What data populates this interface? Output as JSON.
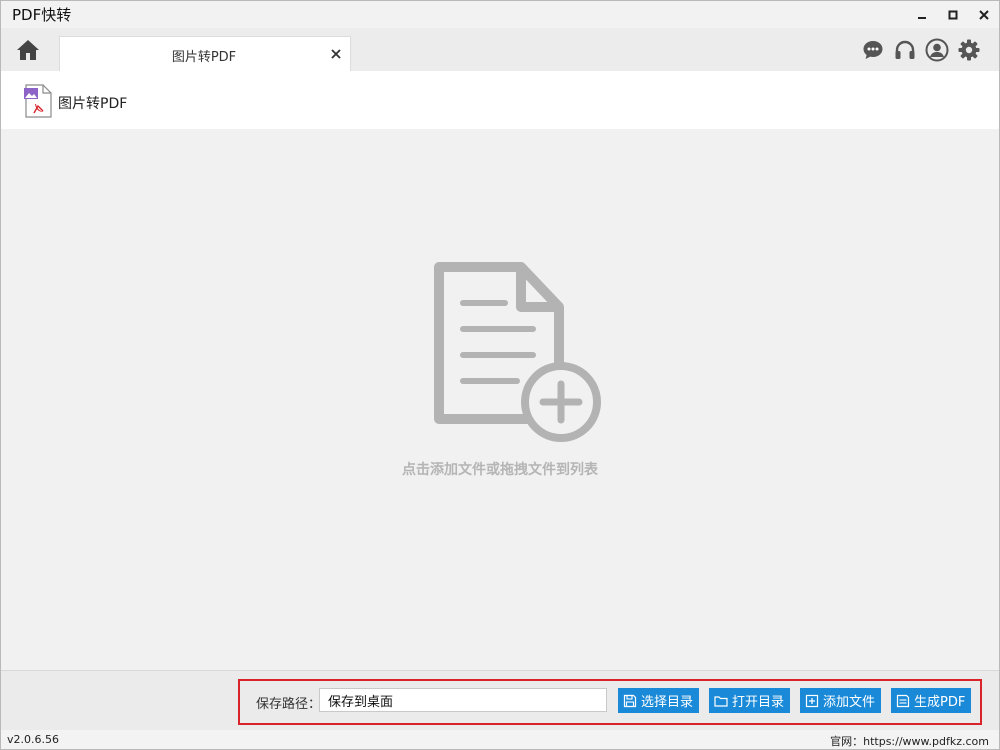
{
  "window": {
    "title": "PDF快转"
  },
  "tabs": [
    {
      "label": "图片转PDF"
    }
  ],
  "icons": {
    "home": "home-icon",
    "chat": "chat-icon",
    "support": "headset-icon",
    "user": "user-icon",
    "settings": "gear-icon"
  },
  "subheader": {
    "title": "图片转PDF"
  },
  "dropzone": {
    "hint": "点击添加文件或拖拽文件到列表"
  },
  "bottom": {
    "save_path_label": "保存路径：",
    "save_path_value": "保存到桌面",
    "buttons": [
      {
        "label": "选择目录",
        "icon": "save-icon"
      },
      {
        "label": "打开目录",
        "icon": "folder-icon"
      },
      {
        "label": "添加文件",
        "icon": "plus-square-icon"
      },
      {
        "label": "生成PDF",
        "icon": "pdf-icon"
      }
    ]
  },
  "status": {
    "version": "v2.0.6.56",
    "website": "官网：https://www.pdfkz.com"
  },
  "colors": {
    "accent": "#1a8ad8",
    "highlight": "#d9232b",
    "icon_gray": "#555555",
    "hint_gray": "#b5b5b5"
  }
}
